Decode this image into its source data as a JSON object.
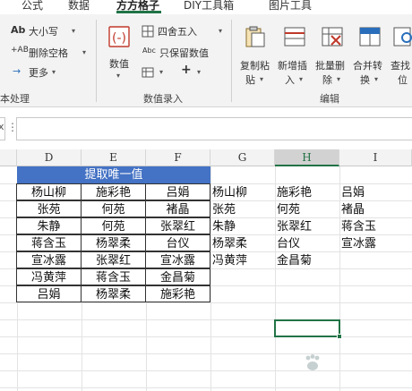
{
  "tabs": [
    "公式",
    "数据",
    "方方格子",
    "DIY工具箱",
    "图片工具"
  ],
  "ribbon": {
    "text_group": {
      "case_label": "大小写",
      "remove_space_label": "删除空格",
      "more_label": "更多",
      "group_label": "本处理"
    },
    "numeric_group": {
      "value_label": "数值",
      "round_label": "四舍五入",
      "keep_value_label": "只保留数值",
      "plus_label": "+",
      "group_label": "数值录入"
    },
    "edit_group": {
      "copy_paste_label_1": "复制粘",
      "copy_paste_label_2": "贴",
      "insert_label_1": "新增插",
      "insert_label_2": "入",
      "batch_delete_label_1": "批量删",
      "batch_delete_label_2": "除",
      "merge_convert_label_1": "合并转",
      "merge_convert_label_2": "换",
      "find_label_1": "查找",
      "find_label_2": "位",
      "group_label": "编辑"
    }
  },
  "formula_bar": {
    "name_box_value": "",
    "formula_value": "",
    "name_box_marker": "x"
  },
  "columns": [
    "D",
    "E",
    "F",
    "G",
    "H",
    "I"
  ],
  "selected_column": "H",
  "title_cell": "提取唯一值",
  "source_table": [
    [
      "杨山柳",
      "施彩艳",
      "吕娟"
    ],
    [
      "张苑",
      "何苑",
      "褚晶"
    ],
    [
      "朱静",
      "何苑",
      "张翠红"
    ],
    [
      "蒋含玉",
      "杨翠柔",
      "台仪"
    ],
    [
      "宣冰露",
      "张翠红",
      "宣冰露"
    ],
    [
      "冯黄萍",
      "蒋含玉",
      "金昌菊"
    ],
    [
      "吕娟",
      "杨翠柔",
      "施彩艳"
    ]
  ],
  "result_columns": {
    "G": [
      "杨山柳",
      "张苑",
      "朱静",
      "杨翠柔",
      "冯黄萍"
    ],
    "H": [
      "施彩艳",
      "何苑",
      "张翠红",
      "台仪",
      "金昌菊"
    ],
    "I": [
      "吕娟",
      "褚晶",
      "蒋含玉",
      "宣冰露"
    ]
  },
  "colors": {
    "accent": "#217346",
    "title_bg": "#4472c4"
  }
}
